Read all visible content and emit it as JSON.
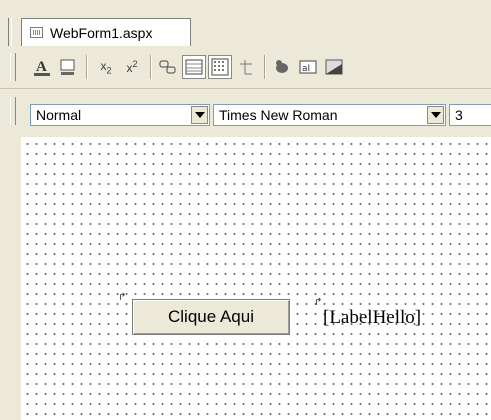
{
  "tabs": [
    {
      "label": "WebForm1.aspx",
      "icon": "webform-icon"
    }
  ],
  "toolbar_formatting": {
    "buttons": [
      {
        "name": "font-color-button",
        "glyph": "A"
      },
      {
        "name": "highlight-button",
        "glyph": "▣"
      },
      {
        "name": "subscript-button",
        "glyph": "x₂"
      },
      {
        "name": "superscript-button",
        "glyph": "x²"
      },
      {
        "name": "hyperlink-button",
        "glyph": "⛓"
      },
      {
        "name": "table-rows-button",
        "glyph": "☰"
      },
      {
        "name": "grid-button",
        "glyph": "▦"
      },
      {
        "name": "insert-table-button",
        "glyph": "⊥"
      },
      {
        "name": "absolute-position-button",
        "glyph": "●"
      },
      {
        "name": "textbox-button",
        "glyph": "a͏"
      },
      {
        "name": "image-button",
        "glyph": "◢"
      }
    ]
  },
  "toolbar_font": {
    "block_format": "Normal",
    "font_name": "Times New Roman",
    "font_size": "3"
  },
  "design_surface": {
    "button_text": "Clique Aqui",
    "label_text": "[LabelHello]",
    "control_glyph": "↱"
  }
}
